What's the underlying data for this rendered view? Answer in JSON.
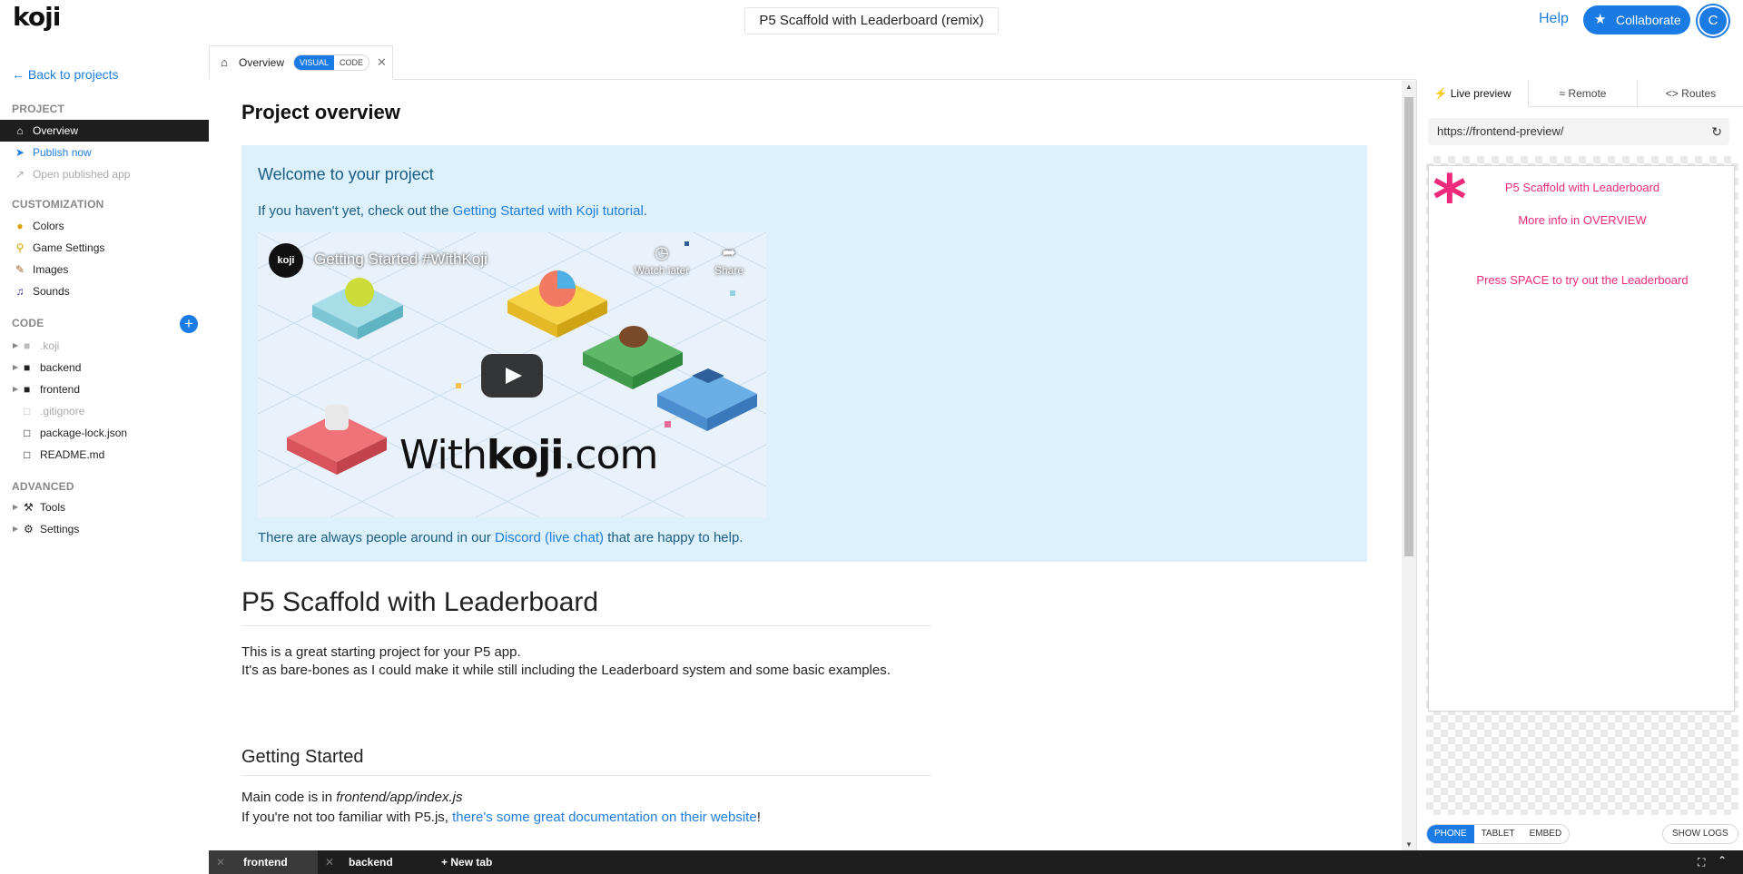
{
  "topbar": {
    "logo": "koji",
    "project_title": "P5 Scaffold with Leaderboard (remix)",
    "help": "Help",
    "collaborate": "Collaborate",
    "avatar_letter": "C"
  },
  "sidebar": {
    "back": "Back to projects",
    "project_heading": "PROJECT",
    "project_items": [
      {
        "label": "Overview",
        "icon": "home-icon"
      },
      {
        "label": "Publish now",
        "icon": "send-icon"
      },
      {
        "label": "Open published app",
        "icon": "external-link-icon"
      }
    ],
    "customization_heading": "CUSTOMIZATION",
    "customization_items": [
      {
        "label": "Colors",
        "icon": "palette-icon"
      },
      {
        "label": "Game Settings",
        "icon": "lightbulb-icon"
      },
      {
        "label": "Images",
        "icon": "image-icon"
      },
      {
        "label": "Sounds",
        "icon": "music-icon"
      }
    ],
    "code_heading": "CODE",
    "code_items": [
      {
        "label": ".koji",
        "icon": "folder-icon"
      },
      {
        "label": "backend",
        "icon": "folder-icon"
      },
      {
        "label": "frontend",
        "icon": "folder-icon"
      },
      {
        "label": ".gitignore",
        "icon": "file-icon"
      },
      {
        "label": "package-lock.json",
        "icon": "file-icon"
      },
      {
        "label": "README.md",
        "icon": "file-icon"
      }
    ],
    "advanced_heading": "ADVANCED",
    "advanced_items": [
      {
        "label": "Tools",
        "icon": "wrench-icon"
      },
      {
        "label": "Settings",
        "icon": "gear-icon"
      }
    ]
  },
  "editor_tab": {
    "label": "Overview",
    "visual": "VISUAL",
    "code": "CODE"
  },
  "overview": {
    "title": "Project overview",
    "welcome_heading": "Welcome to your project",
    "intro_text": "If you haven't yet, check out the ",
    "intro_link": "Getting Started with Koji tutorial",
    "intro_end": ".",
    "video_title": "Getting Started #WithKoji",
    "video_channel_logo": "koji",
    "watch_later": "Watch later",
    "share": "Share",
    "video_brand_light": "With",
    "video_brand_bold": "koji",
    "video_brand_tld": ".com",
    "help_text": "There are always people around in our ",
    "help_link": "Discord (live chat)",
    "help_end": " that are happy to help."
  },
  "readme": {
    "h1": "P5 Scaffold with Leaderboard",
    "p1": "This is a great starting project for your P5 app.",
    "p2": "It's as bare-bones as I could make it while still including the Leaderboard system and some basic examples.",
    "h2": "Getting Started",
    "p3_pre": "Main code is in ",
    "p3_em": "frontend/app/index.js",
    "p4_pre": "If you're not too familiar with P5.js, ",
    "p4_link": "there's some great documentation on their website",
    "p4_end": "!"
  },
  "bottom_tabs": {
    "tab1": "frontend",
    "tab2": "backend",
    "new_tab": "New tab"
  },
  "preview": {
    "tabs": [
      "Live preview",
      "Remote",
      "Routes"
    ],
    "url": "https://frontend-preview/",
    "line1": "P5 Scaffold with Leaderboard",
    "line2": "More info in OVERVIEW",
    "line3": "Press SPACE to try out the Leaderboard",
    "devices": [
      "PHONE",
      "TABLET",
      "EMBED"
    ],
    "show_logs": "SHOW LOGS"
  },
  "colors": {
    "accent": "#1b7be4",
    "pink": "#ee2a7b",
    "welcome_bg": "#dcf1fc"
  }
}
